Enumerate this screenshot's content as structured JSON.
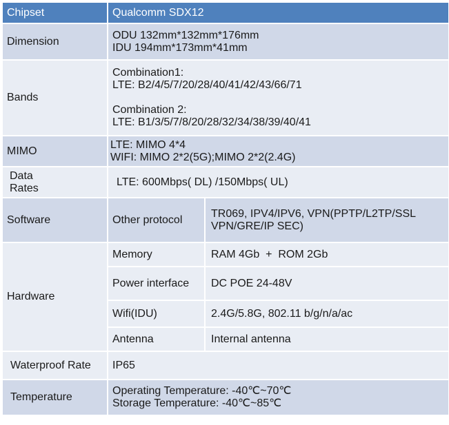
{
  "header": {
    "label": "Chipset",
    "value": "Qualcomm SDX12"
  },
  "dimension": {
    "label": "Dimension",
    "lines": [
      "ODU 132mm*132mm*176mm",
      "IDU 194mm*173mm*41mm"
    ]
  },
  "bands": {
    "label": "Bands",
    "combination1_title": "Combination1:",
    "combination1_value": "LTE: B2/4/5/7/20/28/40/41/42/43/66/71",
    "combination2_title": "Combination 2:",
    "combination2_value": "LTE: B1/3/5/7/8/20/28/32/34/38/39/40/41"
  },
  "mimo": {
    "label": "MIMO",
    "lines": [
      "LTE: MIMO 4*4",
      "WIFI: MIMO 2*2(5G);MIMO 2*2(2.4G)"
    ]
  },
  "data_rates": {
    "label_line1": "Data",
    "label_line2": "Rates",
    "value": "LTE: 600Mbps( DL) /150Mbps( UL)"
  },
  "software": {
    "label": "Software",
    "sub_label": "Other protocol",
    "lines": [
      "TR069, IPV4/IPV6, VPN(PPTP/L2TP/SSL",
      "VPN/GRE/IP SEC)"
    ]
  },
  "hardware": {
    "label": "Hardware",
    "rows": [
      {
        "name": "Memory",
        "value": "RAM 4Gb  +  ROM 2Gb"
      },
      {
        "name": "Power interface",
        "value": "DC POE 24-48V"
      },
      {
        "name": "Wifi(IDU)",
        "value": "2.4G/5.8G, 802.11 b/g/n/a/ac"
      },
      {
        "name": "Antenna",
        "value": "Internal antenna"
      }
    ]
  },
  "waterproof": {
    "label": "Waterproof Rate",
    "value": "IP65"
  },
  "temperature": {
    "label": "Temperature",
    "lines": [
      "Operating Temperature: -40℃~70℃",
      "Storage Temperature: -40℃~85℃"
    ]
  },
  "colors": {
    "header": "#4f81bd",
    "dark_row": "#d0d8e8",
    "light_row": "#e9edf4",
    "header_text": "#ffffff"
  }
}
